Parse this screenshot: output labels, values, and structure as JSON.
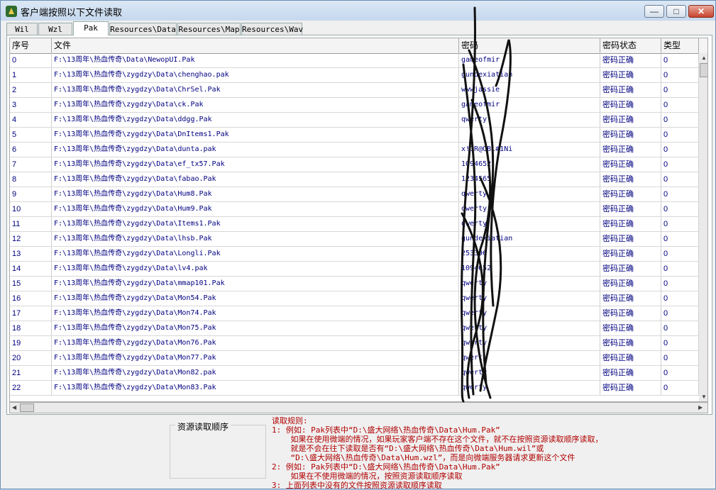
{
  "window": {
    "title": "客户端按照以下文件读取"
  },
  "window_controls": {
    "min": "—",
    "max": "□",
    "close": "✕"
  },
  "tabs": [
    "Wil",
    "Wzl",
    "Pak",
    "Resources\\Data",
    "Resources\\Map",
    "Resources\\Wav"
  ],
  "active_tab": "Pak",
  "columns": [
    "序号",
    "文件",
    "密码",
    "密码状态",
    "类型"
  ],
  "rows": [
    {
      "idx": "0",
      "file": "F:\\13周年\\热血传奇\\Data\\NewopUI.Pak",
      "pwd": "gameofmir",
      "status": "密码正确",
      "type": "0"
    },
    {
      "idx": "1",
      "file": "F:\\13周年\\热血传奇\\zygdzy\\Data\\chenghao.pak",
      "pwd": "gundexiatian",
      "status": "密码正确",
      "type": "0"
    },
    {
      "idx": "2",
      "file": "F:\\13周年\\热血传奇\\zygdzy\\Data\\ChrSel.Pak",
      "pwd": "wwwjassie",
      "status": "密码正确",
      "type": "0"
    },
    {
      "idx": "3",
      "file": "F:\\13周年\\热血传奇\\zygdzy\\Data\\ck.Pak",
      "pwd": "gameofmir",
      "status": "密码正确",
      "type": "0"
    },
    {
      "idx": "4",
      "file": "F:\\13周年\\热血传奇\\zygdzy\\Data\\ddgg.Pak",
      "pwd": "qwerty",
      "status": "密码正确",
      "type": "0"
    },
    {
      "idx": "5",
      "file": "F:\\13周年\\热血传奇\\zygdzy\\Data\\DnItems1.Pak",
      "pwd": "",
      "status": "密码正确",
      "type": "0"
    },
    {
      "idx": "6",
      "file": "F:\\13周年\\热血传奇\\zygdzy\\Data\\dunta.pak",
      "pwd": "x!1R@OBl#1Ni",
      "status": "密码正确",
      "type": "0"
    },
    {
      "idx": "7",
      "file": "F:\\13周年\\热血传奇\\zygdzy\\Data\\ef_tx57.Pak",
      "pwd": "1094652",
      "status": "密码正确",
      "type": "0"
    },
    {
      "idx": "8",
      "file": "F:\\13周年\\热血传奇\\zygdzy\\Data\\fabao.Pak",
      "pwd": "1234565",
      "status": "密码正确",
      "type": "0"
    },
    {
      "idx": "9",
      "file": "F:\\13周年\\热血传奇\\zygdzy\\Data\\Hum8.Pak",
      "pwd": "qwerty",
      "status": "密码正确",
      "type": "0"
    },
    {
      "idx": "10",
      "file": "F:\\13周年\\热血传奇\\zygdzy\\Data\\Hum9.Pak",
      "pwd": "qwerty",
      "status": "密码正确",
      "type": "0"
    },
    {
      "idx": "11",
      "file": "F:\\13周年\\热血传奇\\zygdzy\\Data\\Items1.Pak",
      "pwd": "qwerty",
      "status": "密码正确",
      "type": "0"
    },
    {
      "idx": "12",
      "file": "F:\\13周年\\热血传奇\\zygdzy\\Data\\lhsb.Pak",
      "pwd": "gundexiatian",
      "status": "密码正确",
      "type": "0"
    },
    {
      "idx": "13",
      "file": "F:\\13周年\\热血传奇\\zygdzy\\Data\\Longli.Pak",
      "pwd": "253396",
      "status": "密码正确",
      "type": "0"
    },
    {
      "idx": "14",
      "file": "F:\\13周年\\热血传奇\\zygdzy\\Data\\lv4.pak",
      "pwd": "1094652",
      "status": "密码正确",
      "type": "0"
    },
    {
      "idx": "15",
      "file": "F:\\13周年\\热血传奇\\zygdzy\\Data\\mmap101.Pak",
      "pwd": "qwerty",
      "status": "密码正确",
      "type": "0"
    },
    {
      "idx": "16",
      "file": "F:\\13周年\\热血传奇\\zygdzy\\Data\\Mon54.Pak",
      "pwd": "qwerty",
      "status": "密码正确",
      "type": "0"
    },
    {
      "idx": "17",
      "file": "F:\\13周年\\热血传奇\\zygdzy\\Data\\Mon74.Pak",
      "pwd": "qwerty",
      "status": "密码正确",
      "type": "0"
    },
    {
      "idx": "18",
      "file": "F:\\13周年\\热血传奇\\zygdzy\\Data\\Mon75.Pak",
      "pwd": "qwerty",
      "status": "密码正确",
      "type": "0"
    },
    {
      "idx": "19",
      "file": "F:\\13周年\\热血传奇\\zygdzy\\Data\\Mon76.Pak",
      "pwd": "qwerty",
      "status": "密码正确",
      "type": "0"
    },
    {
      "idx": "20",
      "file": "F:\\13周年\\热血传奇\\zygdzy\\Data\\Mon77.Pak",
      "pwd": "qwerty",
      "status": "密码正确",
      "type": "0"
    },
    {
      "idx": "21",
      "file": "F:\\13周年\\热血传奇\\zygdzy\\Data\\Mon82.pak",
      "pwd": "qwerty",
      "status": "密码正确",
      "type": "0"
    },
    {
      "idx": "22",
      "file": "F:\\13周年\\热血传奇\\zygdzy\\Data\\Mon83.Pak",
      "pwd": "qwerty",
      "status": "密码正确",
      "type": "0"
    }
  ],
  "resource_order_label": "资源读取顺序",
  "rules": [
    "读取规则:",
    "1: 例如: Pak列表中“D:\\盛大网络\\热血传奇\\Data\\Hum.Pak”",
    "    如果在使用微端的情况，如果玩家客户端不存在这个文件，就不在按照资源读取顺序读取，",
    "    就是不会在往下读取是否有“D:\\盛大网络\\热血传奇\\Data\\Hum.wil”或",
    "    “D:\\盛大网络\\热血传奇\\Data\\Hum.wzl”，而是向微端服务器请求更新这个文件",
    "2: 例如: Pak列表中“D:\\盛大网络\\热血传奇\\Data\\Hum.Pak”",
    "    如果在不使用微端的情况，按照资源读取顺序读取",
    "3: 上面列表中没有的文件按照资源读取顺序读取"
  ]
}
